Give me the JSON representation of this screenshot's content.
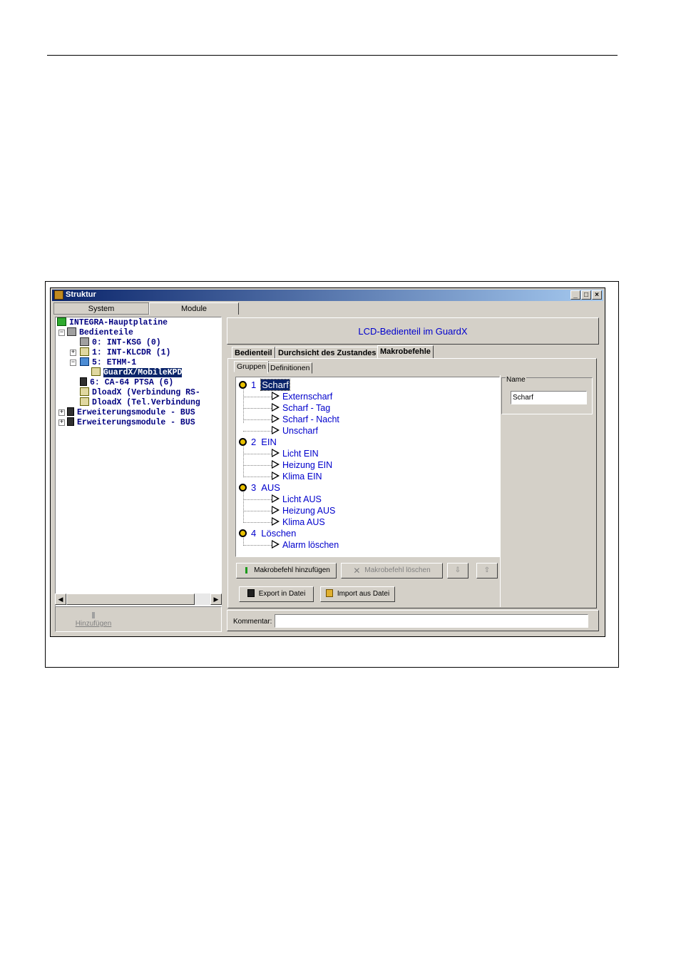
{
  "window": {
    "title": "Struktur",
    "controls": {
      "minimize": "_",
      "maximize": "□",
      "close": "×"
    }
  },
  "top_tabs": [
    "System",
    "Module"
  ],
  "tree": [
    {
      "label": "INTEGRA-Hauptplatine",
      "icon": "mainboard-icon"
    },
    {
      "label": "Bedienteile",
      "icon": "keypad-group-icon"
    },
    {
      "label": "0:  INT-KSG      (0)",
      "icon": "keypad-icon"
    },
    {
      "label": "1:  INT-KLCDR    (1)",
      "icon": "keypad-icon"
    },
    {
      "label": "5:  ETHM-1",
      "icon": "ethernet-module-icon"
    },
    {
      "label": "GuardX/MobileKPD",
      "icon": "virtual-keypad-icon"
    },
    {
      "label": "6:  CA-64 PTSA   (6)",
      "icon": "panel-icon"
    },
    {
      "label": "DloadX (Verbindung RS-",
      "icon": "dloadx-icon"
    },
    {
      "label": "DloadX (Tel.Verbindung",
      "icon": "dloadx-icon"
    },
    {
      "label": "Erweiterungsmodule - BUS",
      "icon": "expander-icon"
    },
    {
      "label": "Erweiterungsmodule - BUS",
      "icon": "expander-icon"
    }
  ],
  "left_button": "Hinzufügen",
  "header_title": "LCD-Bedienteil im GuardX",
  "tabs": [
    "Bedienteil",
    "Durchsicht des Zustandes",
    "Makrobefehle"
  ],
  "subtabs": [
    "Gruppen",
    "Definitionen"
  ],
  "groups": [
    {
      "num": "1",
      "name": "Scharf",
      "items": [
        "Externscharf",
        "Scharf - Tag",
        "Scharf - Nacht",
        "Unscharf"
      ]
    },
    {
      "num": "2",
      "name": "EIN",
      "items": [
        "Licht EIN",
        "Heizung EIN",
        "Klima EIN"
      ]
    },
    {
      "num": "3",
      "name": "AUS",
      "items": [
        "Licht AUS",
        "Heizung AUS",
        "Klima AUS"
      ]
    },
    {
      "num": "4",
      "name": "Löschen",
      "items": [
        "Alarm löschen"
      ]
    }
  ],
  "name_panel": {
    "legend": "Name",
    "value": "Scharf"
  },
  "buttons": {
    "add_macro": "Makrobefehl hinzufügen",
    "delete_macro": "Makrobefehl löschen",
    "down": "⇩",
    "up": "⇧",
    "export": "Export in Datei",
    "import": "Import aus Datei"
  },
  "comment_label": "Kommentar:",
  "comment_value": ""
}
